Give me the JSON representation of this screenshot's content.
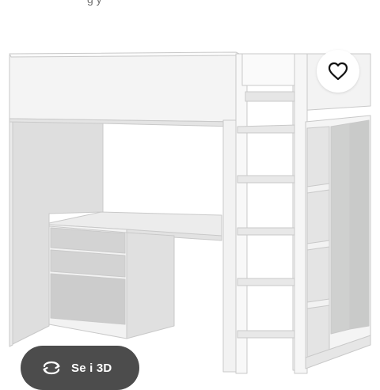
{
  "caption": {
    "text": "g        y"
  },
  "favorite": {
    "icon": "heart-outline-icon"
  },
  "view3d": {
    "label": "Se i 3D",
    "icon": "rotate-3d-icon"
  },
  "colors": {
    "button_dark": "#4c4c4c",
    "furniture_white": "#f6f6f6",
    "panel_grey": "#cfd0cf"
  }
}
